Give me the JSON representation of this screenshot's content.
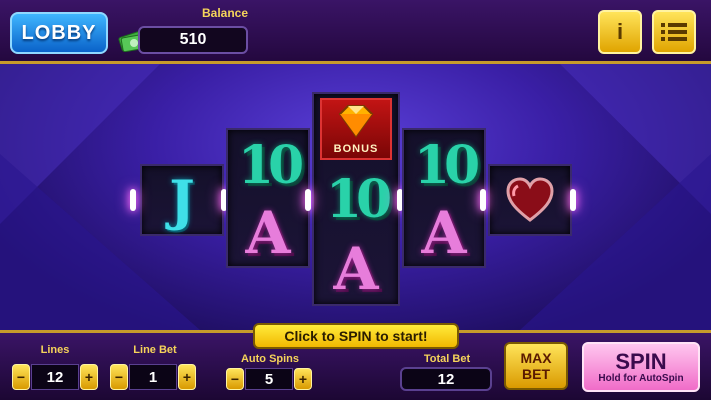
{
  "topbar": {
    "lobby_label": "LOBBY",
    "balance_label": "Balance",
    "balance_value": "510",
    "info_label": "i"
  },
  "reels": {
    "bonus_label": "BONUS",
    "symbols": [
      "J",
      "10",
      "A",
      "10",
      "A",
      "10",
      "A"
    ]
  },
  "prompt": "Click to SPIN to start!",
  "controls": {
    "lines_label": "Lines",
    "lines_value": "12",
    "linebet_label": "Line Bet",
    "linebet_value": "1",
    "autospins_label": "Auto Spins",
    "autospins_value": "5",
    "totalbet_label": "Total Bet",
    "totalbet_value": "12",
    "minus": "−",
    "plus": "+",
    "maxbet_line1": "MAX",
    "maxbet_line2": "BET",
    "spin_label": "SPIN",
    "spin_sub": "Hold for AutoSpin"
  },
  "colors": {
    "accent_gold": "#f5d35a",
    "lobby_blue": "#0a62c9",
    "spin_pink": "#f06cc8"
  }
}
